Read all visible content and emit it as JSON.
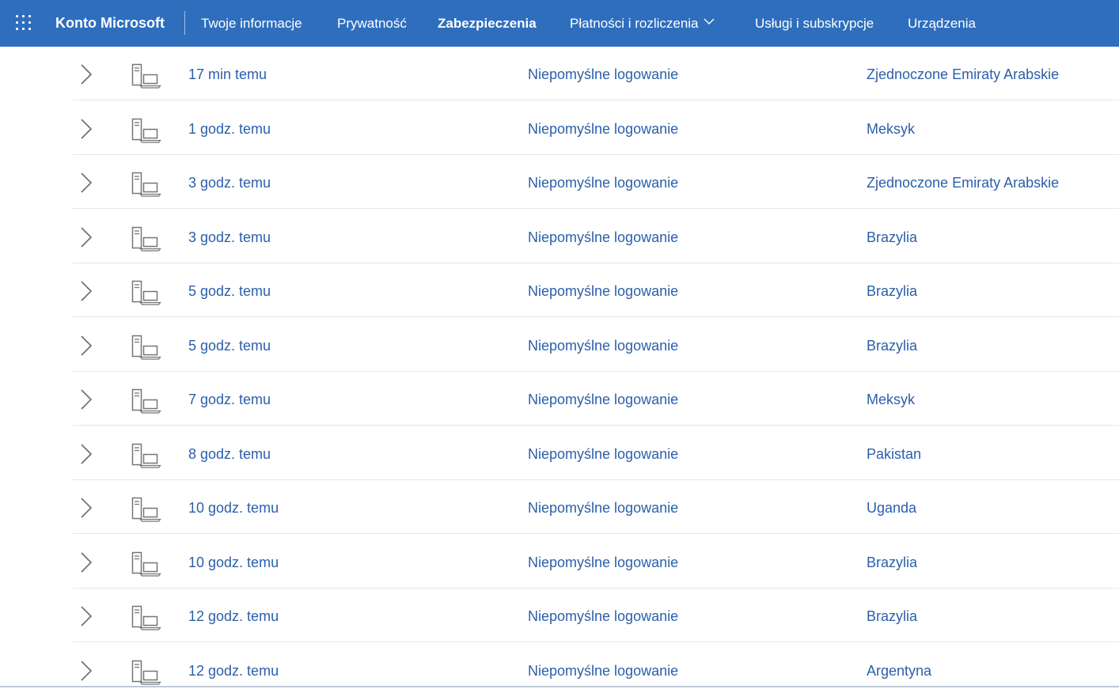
{
  "header": {
    "brand": "Konto Microsoft",
    "nav": [
      {
        "label": "Twoje informacje",
        "active": false
      },
      {
        "label": "Prywatność",
        "active": false
      },
      {
        "label": "Zabezpieczenia",
        "active": true
      },
      {
        "label": "Płatności i rozliczenia",
        "active": false,
        "has_dropdown": true
      },
      {
        "label": "Usługi i subskrypcje",
        "active": false
      },
      {
        "label": "Urządzenia",
        "active": false
      }
    ]
  },
  "colors": {
    "header_bg": "#2f6ebd",
    "link": "#2b5faa",
    "separator": "#e6e6e6",
    "icon": "#767676"
  },
  "activity": [
    {
      "time": "17 min temu",
      "status": "Niepomyślne logowanie",
      "location": "Zjednoczone Emiraty Arabskie"
    },
    {
      "time": "1 godz. temu",
      "status": "Niepomyślne logowanie",
      "location": "Meksyk"
    },
    {
      "time": "3 godz. temu",
      "status": "Niepomyślne logowanie",
      "location": "Zjednoczone Emiraty Arabskie"
    },
    {
      "time": "3 godz. temu",
      "status": "Niepomyślne logowanie",
      "location": "Brazylia"
    },
    {
      "time": "5 godz. temu",
      "status": "Niepomyślne logowanie",
      "location": "Brazylia"
    },
    {
      "time": "5 godz. temu",
      "status": "Niepomyślne logowanie",
      "location": "Brazylia"
    },
    {
      "time": "7 godz. temu",
      "status": "Niepomyślne logowanie",
      "location": "Meksyk"
    },
    {
      "time": "8 godz. temu",
      "status": "Niepomyślne logowanie",
      "location": "Pakistan"
    },
    {
      "time": "10 godz. temu",
      "status": "Niepomyślne logowanie",
      "location": "Uganda"
    },
    {
      "time": "10 godz. temu",
      "status": "Niepomyślne logowanie",
      "location": "Brazylia"
    },
    {
      "time": "12 godz. temu",
      "status": "Niepomyślne logowanie",
      "location": "Brazylia"
    },
    {
      "time": "12 godz. temu",
      "status": "Niepomyślne logowanie",
      "location": "Argentyna"
    }
  ]
}
